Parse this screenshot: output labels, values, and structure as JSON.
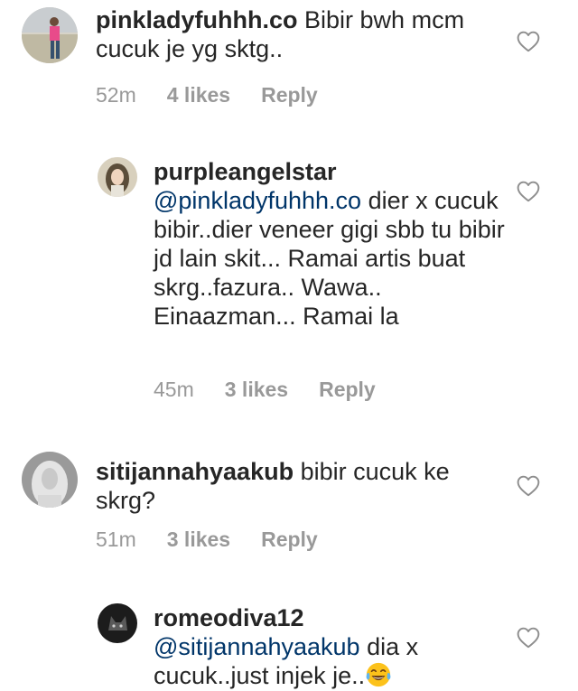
{
  "comments": [
    {
      "username": "pinkladyfuhhh.co",
      "mention": "",
      "text": "Bibir bwh mcm cucuk je yg sktg..",
      "time": "52m",
      "likes": "4 likes",
      "reply": "Reply",
      "avatar": "avatar-pink-person",
      "is_reply": false
    },
    {
      "username": "purpleangelstar",
      "mention": "@pinkladyfuhhh.co",
      "text": "dier x cucuk bibir..dier veneer gigi sbb tu bibir jd lain skit... Ramai artis buat skrg..fazura.. Wawa.. Einaazman... Ramai la",
      "time": "45m",
      "likes": "3 likes",
      "reply": "Reply",
      "avatar": "avatar-hijab-selfie",
      "is_reply": true
    },
    {
      "username": "sitijannahyaakub",
      "mention": "",
      "text": "bibir cucuk ke skrg?",
      "time": "51m",
      "likes": "3 likes",
      "reply": "Reply",
      "avatar": "avatar-hijab-grey",
      "is_reply": false
    },
    {
      "username": "romeodiva12",
      "mention": "@sitijannahyaakub",
      "text": "dia x cucuk..just injek je..",
      "emoji": "face-with-tears-of-joy",
      "time": "",
      "likes": "",
      "reply": "",
      "avatar": "avatar-dark-cat",
      "is_reply": true
    }
  ],
  "colors": {
    "text": "#262626",
    "meta": "#999999",
    "mention": "#003569",
    "heart": "#8e8e8e"
  },
  "icons": {
    "like": "heart-outline-icon",
    "emoji": "tears-of-joy-emoji"
  }
}
